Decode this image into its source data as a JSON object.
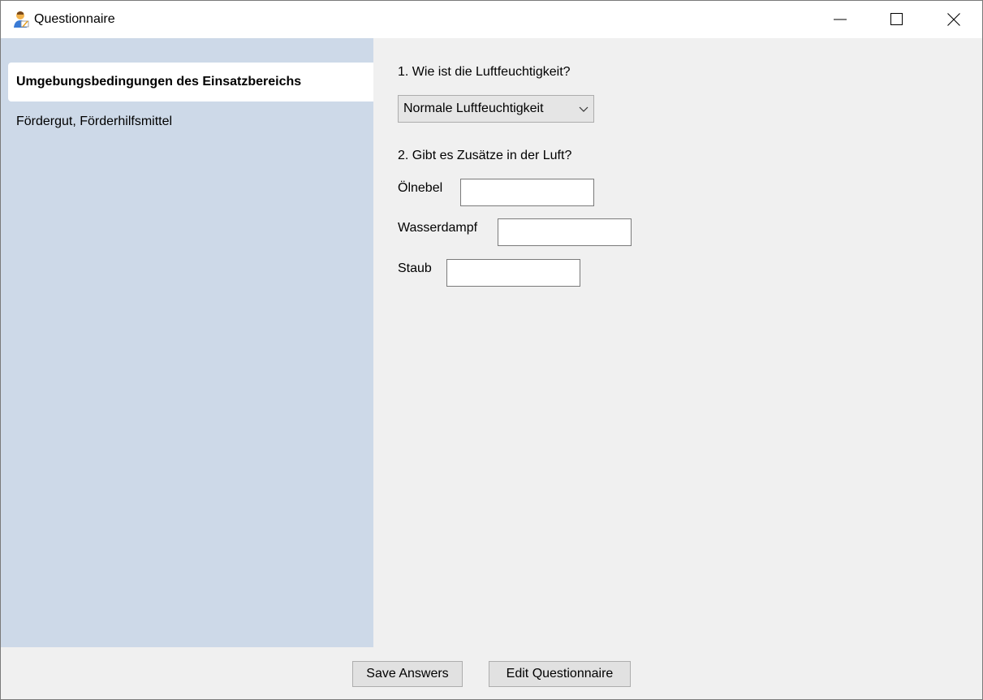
{
  "window": {
    "title": "Questionnaire",
    "icon": "user-writing-icon"
  },
  "sidebar": {
    "items": [
      {
        "label": "Umgebungsbedingungen des Einsatzbereichs",
        "active": true
      },
      {
        "label": "Fördergut, Förderhilfsmittel",
        "active": false
      }
    ]
  },
  "questions": {
    "q1": {
      "label": "1. Wie ist die Luftfeuchtigkeit?",
      "selected": "Normale Luftfeuchtigkeit"
    },
    "q2": {
      "label": "2. Gibt es Zusätze in der Luft?",
      "fields": [
        {
          "label": "Ölnebel",
          "value": ""
        },
        {
          "label": "Wasserdampf",
          "value": ""
        },
        {
          "label": "Staub",
          "value": ""
        }
      ]
    }
  },
  "buttons": {
    "save": "Save Answers",
    "edit": "Edit Questionnaire"
  },
  "colors": {
    "sidebar_bg": "#cdd9e8",
    "window_bg": "#f0f0f0",
    "button_bg": "#e1e1e1"
  }
}
